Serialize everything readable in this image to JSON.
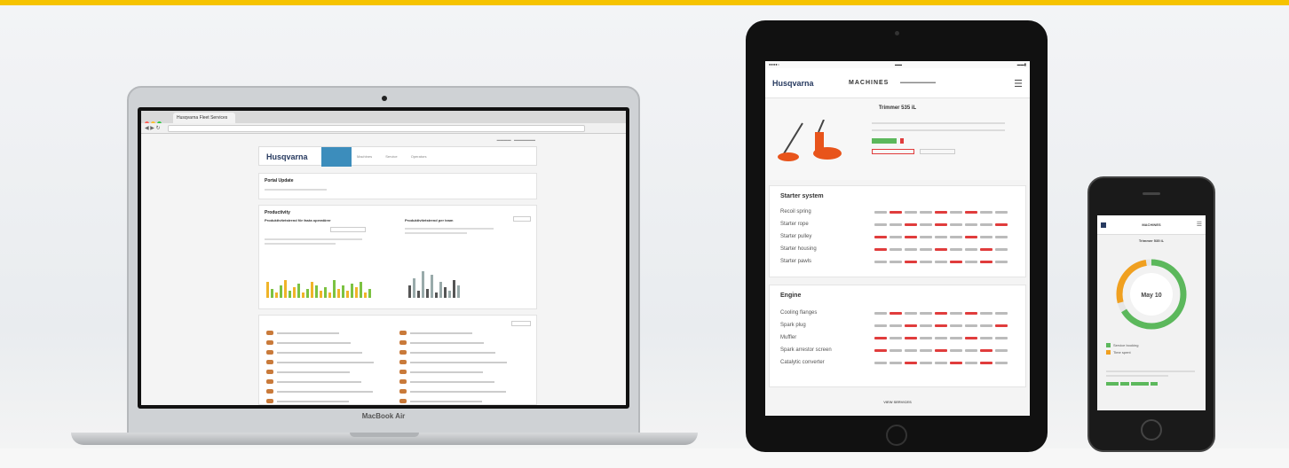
{
  "laptop": {
    "brand": "MacBook Air",
    "browser_tab": "Husqvarna Fleet Services",
    "logo": "Husqvarna",
    "nav_items": [
      "Overview",
      "Machines",
      "Service",
      "Operators"
    ],
    "portal_update_title": "Portal Update",
    "productivity_title": "Productivity",
    "chart_left_title": "Produktivitetstrend för fasta operatörer",
    "chart_right_title": "Produktivitetstrend per team"
  },
  "tablet": {
    "logo": "Husqvarna",
    "section_title": "MACHINES",
    "product_name": "Trimmer 535 iL",
    "starter_section": "Starter system",
    "starter_rows": [
      "Recoil spring",
      "Starter rope",
      "Starter pulley",
      "Starter housing",
      "Starter pawls"
    ],
    "engine_section": "Engine",
    "engine_rows": [
      "Cooling flanges",
      "Spark plug",
      "Muffler",
      "Spark arrestor screen",
      "Catalytic converter"
    ],
    "more_label": "VIEW SERVICES"
  },
  "phone": {
    "title": "MACHINES",
    "product_name": "Trimmer 535 iL",
    "gauge_label": "May 10",
    "legend": [
      "Service booking",
      "Time spent"
    ]
  },
  "colors": {
    "accent_yellow": "#f6c300",
    "brand_blue": "#273a60",
    "ok_green": "#5cb85c",
    "alert_red": "#e03c3c",
    "orange": "#f0a020"
  }
}
